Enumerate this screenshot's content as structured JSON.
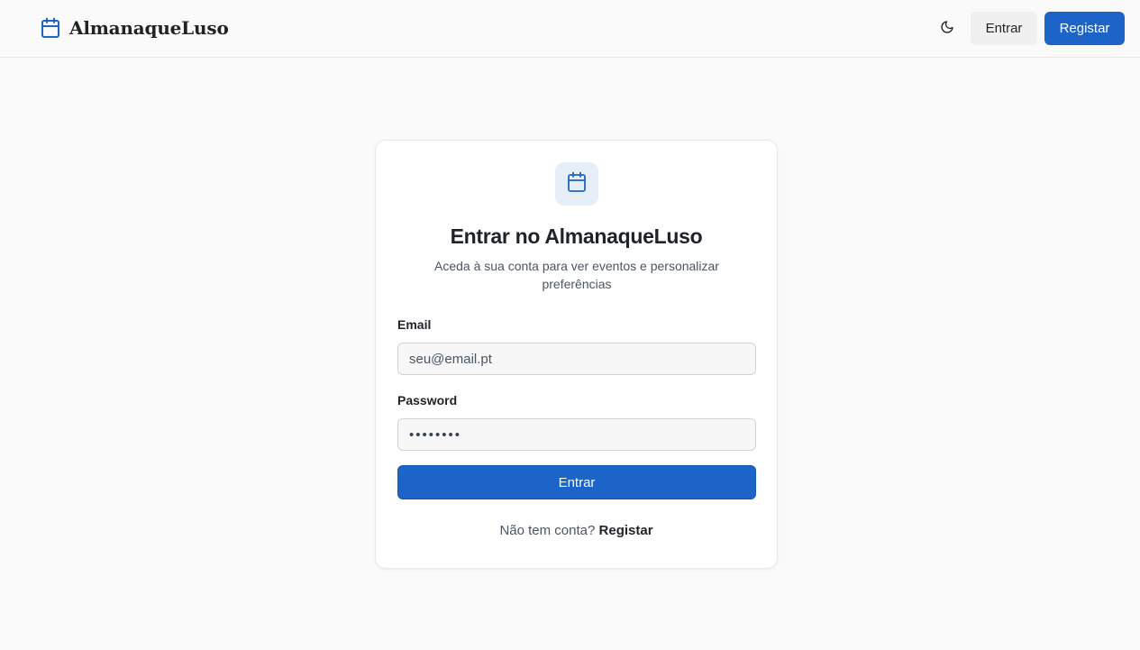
{
  "header": {
    "brand_name": "AlmanaqueLuso",
    "brand_icon": "calendar-icon",
    "theme_icon": "moon-icon",
    "login_label": "Entrar",
    "register_label": "Registar"
  },
  "card": {
    "icon": "calendar-icon",
    "title": "Entrar no AlmanaqueLuso",
    "subtitle": "Aceda à sua conta para ver eventos e personalizar preferências",
    "email_label": "Email",
    "email_placeholder": "seu@email.pt",
    "password_label": "Password",
    "password_value": "••••••••",
    "submit_label": "Entrar",
    "no_account_text": "Não tem conta?",
    "register_link": "Registar"
  },
  "colors": {
    "accent": "#1c64c8",
    "background": "#fafafa",
    "icon_bg": "#e6eef8"
  }
}
